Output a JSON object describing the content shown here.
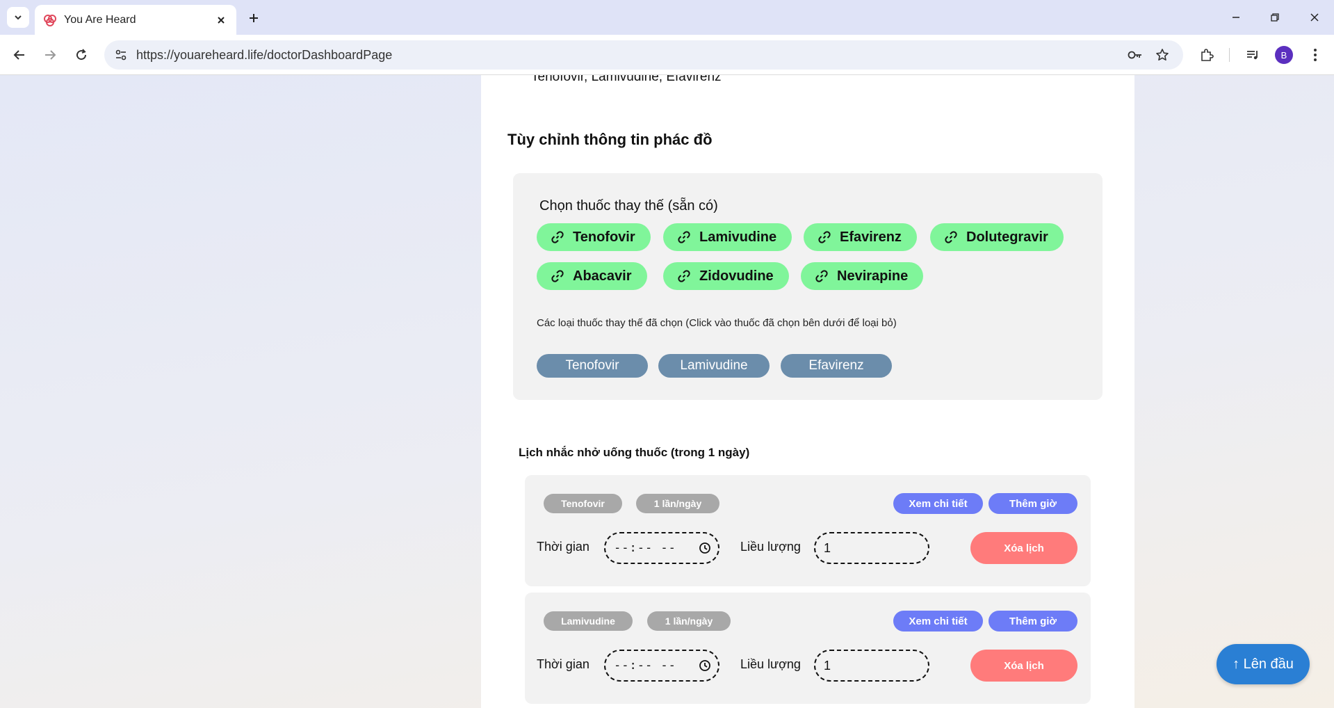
{
  "browser": {
    "tab_title": "You Are Heard",
    "url": "https://youareheard.life/doctorDashboardPage",
    "profile_initial": "B"
  },
  "page": {
    "clipped_text": "Tenofovir, Lamivudine, Efavirenz",
    "section_title": "Tùy chỉnh thông tin phác đồ",
    "available_label": "Chọn thuốc thay thế (sẵn có)",
    "available_drugs": [
      "Tenofovir",
      "Lamivudine",
      "Efavirenz",
      "Dolutegravir",
      "Abacavir",
      "Zidovudine",
      "Nevirapine"
    ],
    "selected_note": "Các loại thuốc thay thế đã chọn (Click vào thuốc đã chọn bên dưới để loại bỏ)",
    "selected_drugs": [
      "Tenofovir",
      "Lamivudine",
      "Efavirenz"
    ],
    "schedule_title": "Lịch nhắc nhở uống thuốc (trong 1 ngày)",
    "schedules": [
      {
        "drug": "Tenofovir",
        "frequency": "1 lần/ngày",
        "details_label": "Xem chi tiết",
        "add_time_label": "Thêm giờ",
        "time_label": "Thời gian",
        "time_value": "--:-- --",
        "dose_label": "Liều lượng",
        "dose_value": "1",
        "delete_label": "Xóa lịch"
      },
      {
        "drug": "Lamivudine",
        "frequency": "1 lần/ngày",
        "details_label": "Xem chi tiết",
        "add_time_label": "Thêm giờ",
        "time_label": "Thời gian",
        "time_value": "--:-- --",
        "dose_label": "Liều lượng",
        "dose_value": "1",
        "delete_label": "Xóa lịch"
      }
    ],
    "scroll_top_label": "↑ Lên đầu"
  },
  "colors": {
    "available_chip": "#80f59a",
    "selected_chip": "#6b8dab",
    "action_blue": "#6d7cf7",
    "delete_red": "#ff7b7b",
    "scroll_top": "#2a7fd4"
  }
}
